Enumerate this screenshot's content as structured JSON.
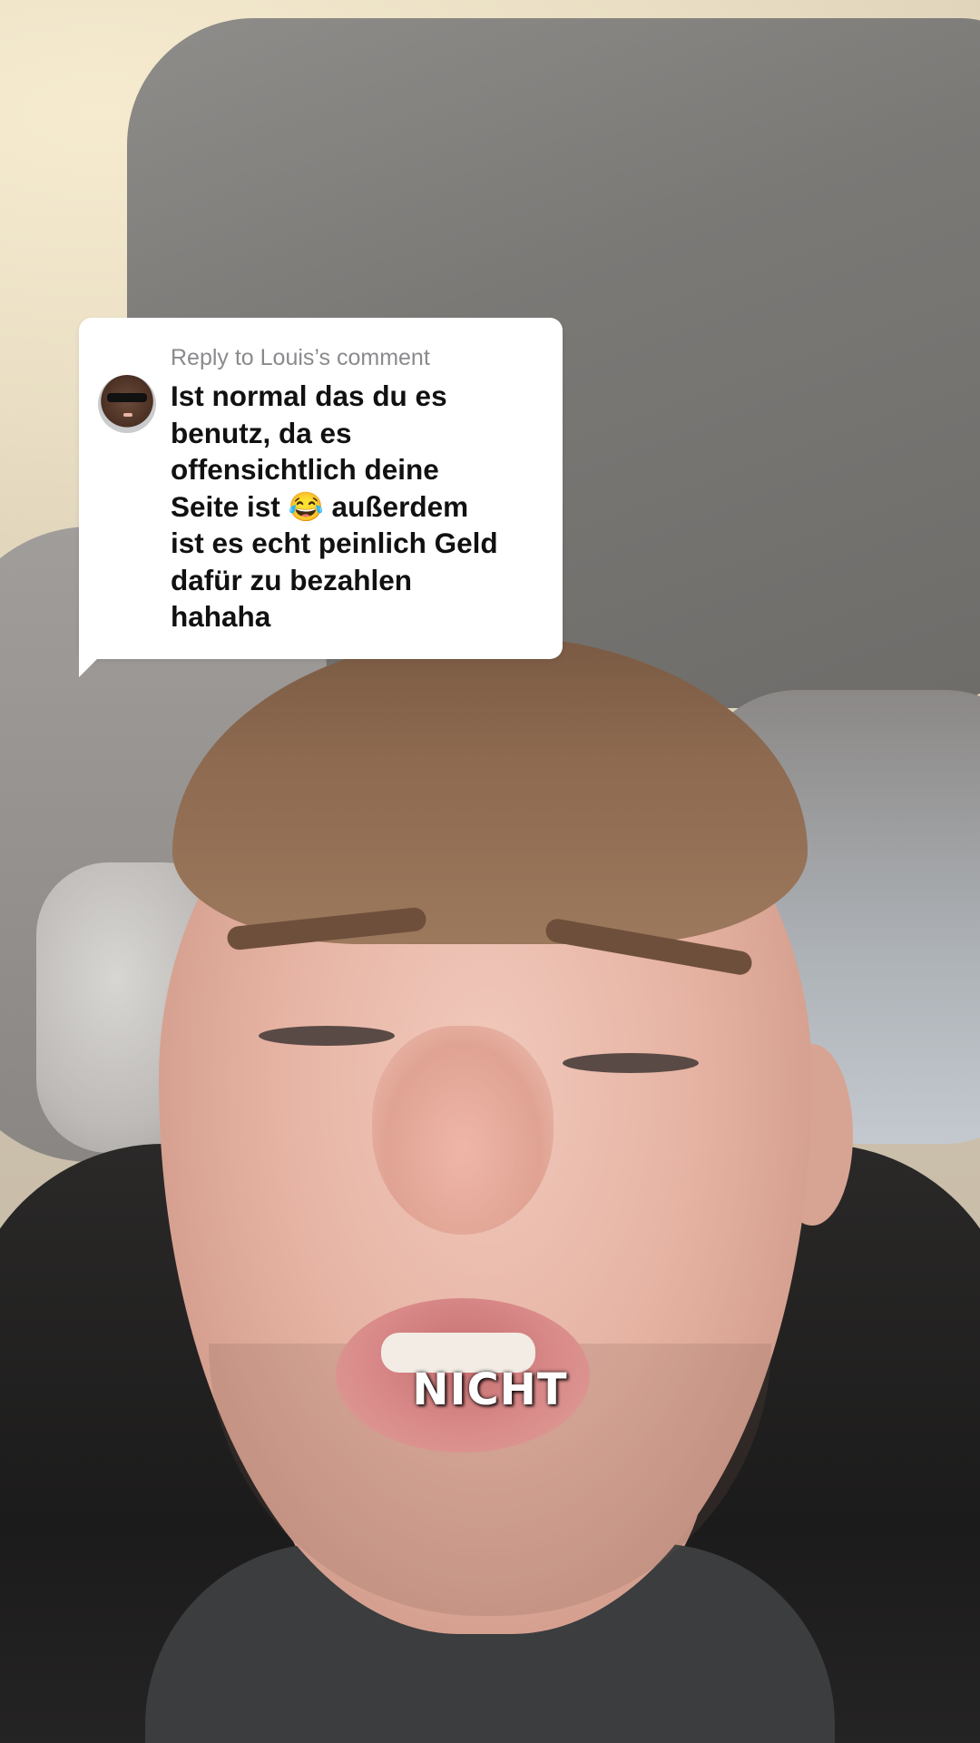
{
  "comment_reply": {
    "reply_label": "Reply to Louis’s comment",
    "comment_line_1": "Ist normal das du es",
    "comment_line_2": "benutz, da es",
    "comment_line_3": "offensichtlich deine",
    "comment_line_4_pre": "Seite ist ",
    "comment_emoji": "😂",
    "comment_line_4_post": " außerdem",
    "comment_line_5": "ist es echt peinlich Geld",
    "comment_line_6": "dafür zu bezahlen",
    "comment_line_7": "hahaha",
    "avatar_icon": "user-avatar-icon"
  },
  "caption": {
    "text": "NICHT"
  },
  "colors": {
    "bubble_background": "#ffffff",
    "reply_label_color": "#8a8a8e",
    "comment_text_color": "#111111",
    "caption_color": "#ffffff"
  }
}
